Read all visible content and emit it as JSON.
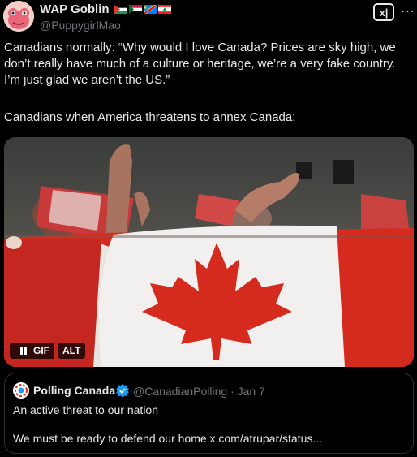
{
  "author": {
    "display_name": "WAP Goblin",
    "handle": "@PuppygirlMao",
    "avatar_icon": "pink-frog-avatar",
    "flags": [
      "palestine-flag-icon",
      "sudan-flag-icon",
      "congo-flag-icon",
      "lebanon-flag-icon"
    ]
  },
  "actions": {
    "grok_label": "x|",
    "more_label": "···"
  },
  "post": {
    "text": "Canadians normally: “Why would I love Canada? Prices are sky high, we don’t really have much of a culture or heritage, we’re a very fake country. I’m just glad we aren’t the US.”",
    "text_2": "Canadians when America threatens to annex Canada:"
  },
  "media": {
    "type": "gif",
    "subject": "canada-flag-crowd",
    "gif_label": "GIF",
    "alt_label": "ALT"
  },
  "quote": {
    "display_name": "Polling Canada",
    "handle_date": "@CanadianPolling · Jan 7",
    "line_1": "An active threat to our nation",
    "line_2": "We must be ready to defend our home x.com/atrupar/status..."
  },
  "colors": {
    "background": "#000000",
    "text": "#e7e9ea",
    "muted": "#71767b",
    "verified": "#1d9bf0",
    "flag_red": "#d52b1e"
  }
}
